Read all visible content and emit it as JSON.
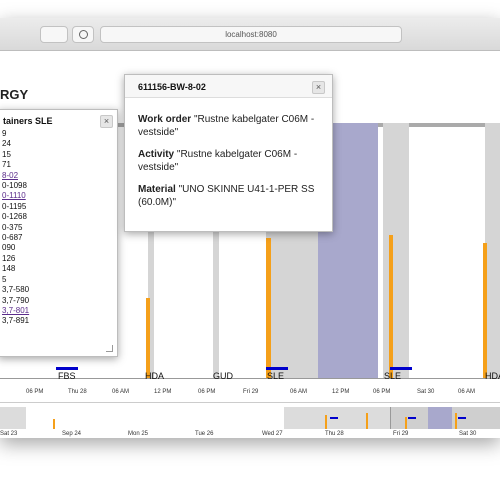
{
  "browser": {
    "url": "localhost:8080"
  },
  "app": {
    "title_fragment": "RGY"
  },
  "timeline": {
    "main_ticks": [
      "06 PM",
      "Thu 28",
      "06 AM",
      "12 PM",
      "06 PM",
      "Fri 29",
      "06 AM",
      "12 PM",
      "06 PM",
      "Sat 30",
      "06 AM",
      "12 PM"
    ],
    "locations": [
      "FBS",
      "HDA",
      "GUD",
      "SLE",
      "SLE",
      "HDA"
    ],
    "overview_ticks": [
      "Sat 23",
      "Sep 24",
      "Mon 25",
      "Tue 26",
      "Wed 27",
      "Thu 28",
      "Fri 29",
      "Sat 30"
    ]
  },
  "list_popup": {
    "title": "tainers SLE",
    "close": "×",
    "items": [
      "9",
      "24",
      "15",
      "71",
      "8-02",
      "0-1098",
      "0-1110",
      "0-1195",
      "0-1268",
      "0-375",
      "0-687",
      "090",
      "126",
      "148",
      "5",
      "3,7-580",
      "3,7-790",
      "3,7-801",
      "3,7-891"
    ]
  },
  "detail_popup": {
    "title": "611156-BW-8-02",
    "close": "×",
    "work_order_label": "Work order",
    "work_order_value": "\"Rustne kabelgater C06M - vestside\"",
    "activity_label": "Activity",
    "activity_value": "\"Rustne kabelgater C06M - vestside\"",
    "material_label": "Material",
    "material_value": "\"UNO SKINNE U41-1-PER SS (60.0M)\""
  }
}
